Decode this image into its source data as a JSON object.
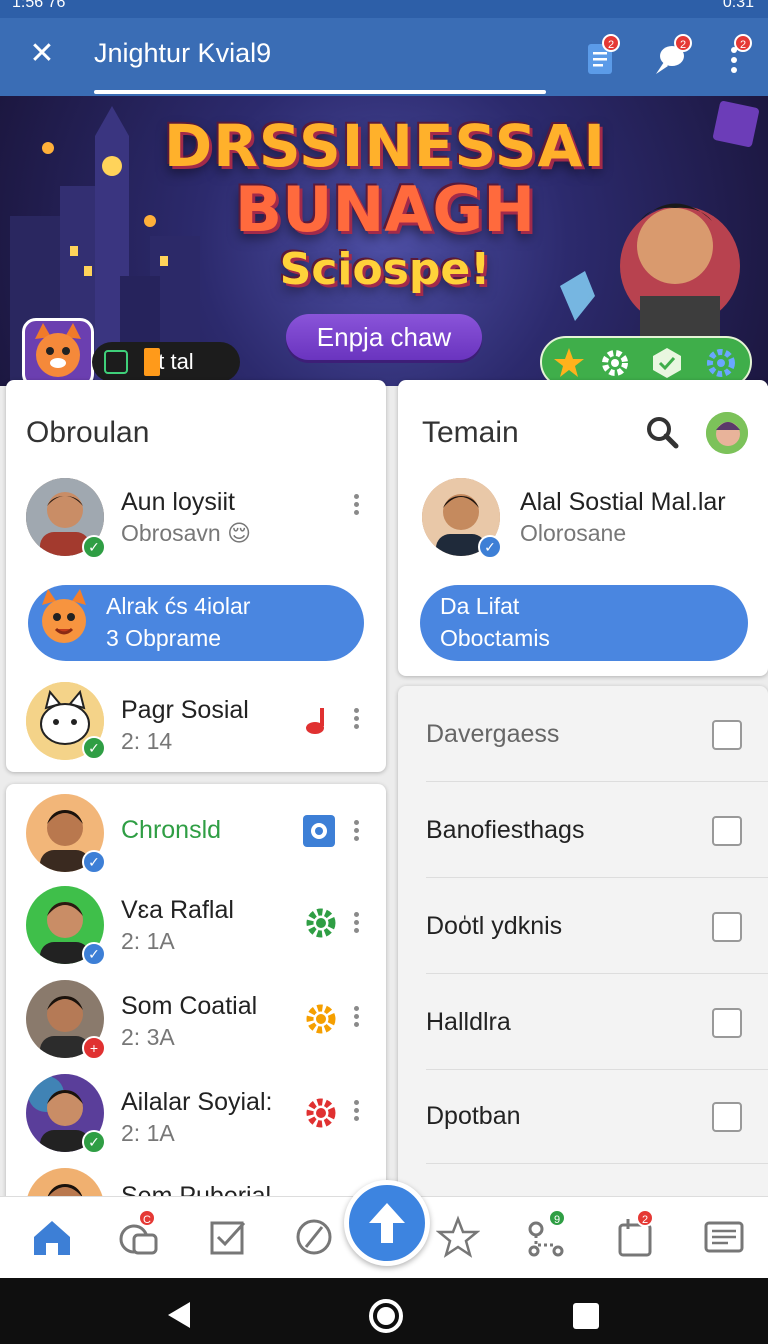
{
  "status_bar": {
    "time_left": "1:56 76",
    "time_right": "0:31"
  },
  "appbar": {
    "title": "Jnightur Kvial9",
    "badges": {
      "doc": "2",
      "pin": "2",
      "more": "2"
    }
  },
  "banner": {
    "headline_1": "DRSSINESSAI",
    "headline_2": "BUNAGH",
    "headline_3": "Sciospe!",
    "cta": "Enpja chaw",
    "pill_text": "ot tal"
  },
  "left_card": {
    "title": "Obroulan",
    "items": [
      {
        "name": "Aun loysiit",
        "sub": "Obrosavn 😌"
      },
      {
        "name": "Alrak ćs 4iolar",
        "sub": "3 Obprame"
      },
      {
        "name": "Pagr Sosial",
        "sub": "2: 14"
      }
    ]
  },
  "right_card": {
    "title": "Temain",
    "item": {
      "name": "Alal Sostial Mal.lar",
      "sub": "Olorosane"
    },
    "pill": {
      "l1": "Da Lifat",
      "l2": "Oboctamis"
    }
  },
  "contacts": [
    {
      "name": "Chronsld",
      "sub": ""
    },
    {
      "name": "Vɛa Raflal",
      "sub": "2: 1A"
    },
    {
      "name": "Som Coatial",
      "sub": "2: 3A"
    },
    {
      "name": "Ailalar Soyial:",
      "sub": "2: 1A"
    },
    {
      "name": "Sem Puberial",
      "sub": ""
    }
  ],
  "checklist": [
    "Davergaess",
    "Banofiesthags",
    "Doo̍tl ydknis",
    "Halldlra",
    "Dpotban"
  ],
  "bottom_nav": {
    "chat_badge": "C",
    "map_badge": "9",
    "cal_badge": "2"
  },
  "colors": {
    "primary": "#3a6db5",
    "accent_blue": "#4a86e0",
    "green": "#2f9e44",
    "contact_green": "#2f9e44"
  }
}
